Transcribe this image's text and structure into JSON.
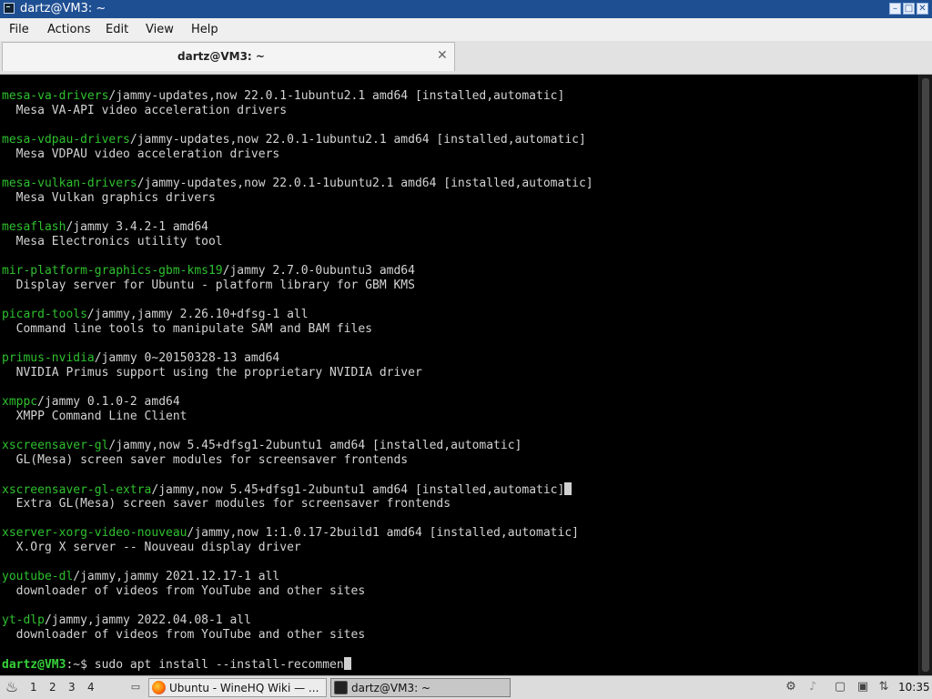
{
  "window": {
    "title": "dartz@VM3: ~",
    "buttons": {
      "minimize": "–",
      "maximize": "□",
      "close": "✕"
    }
  },
  "menu": {
    "items": [
      "File",
      "Actions",
      "Edit",
      "View",
      "Help"
    ]
  },
  "tab": {
    "label": "dartz@VM3: ~",
    "close": "✕"
  },
  "terminal": {
    "lines": [
      {
        "pkg": "mesa-va-drivers",
        "rest": "/jammy-updates,now 22.0.1-1ubuntu2.1 amd64 [installed,automatic]"
      },
      {
        "text": "  Mesa VA-API video acceleration drivers"
      },
      {
        "text": ""
      },
      {
        "pkg": "mesa-vdpau-drivers",
        "rest": "/jammy-updates,now 22.0.1-1ubuntu2.1 amd64 [installed,automatic]"
      },
      {
        "text": "  Mesa VDPAU video acceleration drivers"
      },
      {
        "text": ""
      },
      {
        "pkg": "mesa-vulkan-drivers",
        "rest": "/jammy-updates,now 22.0.1-1ubuntu2.1 amd64 [installed,automatic]"
      },
      {
        "text": "  Mesa Vulkan graphics drivers"
      },
      {
        "text": ""
      },
      {
        "pkg": "mesaflash",
        "rest": "/jammy 3.4.2-1 amd64"
      },
      {
        "text": "  Mesa Electronics utility tool"
      },
      {
        "text": ""
      },
      {
        "pkg": "mir-platform-graphics-gbm-kms19",
        "rest": "/jammy 2.7.0-0ubuntu3 amd64"
      },
      {
        "text": "  Display server for Ubuntu - platform library for GBM KMS"
      },
      {
        "text": ""
      },
      {
        "pkg": "picard-tools",
        "rest": "/jammy,jammy 2.26.10+dfsg-1 all"
      },
      {
        "text": "  Command line tools to manipulate SAM and BAM files"
      },
      {
        "text": ""
      },
      {
        "pkg": "primus-nvidia",
        "rest": "/jammy 0~20150328-13 amd64"
      },
      {
        "text": "  NVIDIA Primus support using the proprietary NVIDIA driver"
      },
      {
        "text": ""
      },
      {
        "pkg": "xmppc",
        "rest": "/jammy 0.1.0-2 amd64"
      },
      {
        "text": "  XMPP Command Line Client"
      },
      {
        "text": ""
      },
      {
        "pkg": "xscreensaver-gl",
        "rest": "/jammy,now 5.45+dfsg1-2ubuntu1 amd64 [installed,automatic]"
      },
      {
        "text": "  GL(Mesa) screen saver modules for screensaver frontends"
      },
      {
        "text": ""
      },
      {
        "pkg": "xscreensaver-gl-extra",
        "rest": "/jammy,now 5.45+dfsg1-2ubuntu1 amd64 [installed,automatic]",
        "cursor": true
      },
      {
        "text": "  Extra GL(Mesa) screen saver modules for screensaver frontends"
      },
      {
        "text": ""
      },
      {
        "pkg": "xserver-xorg-video-nouveau",
        "rest": "/jammy,now 1:1.0.17-2build1 amd64 [installed,automatic]"
      },
      {
        "text": "  X.Org X server -- Nouveau display driver"
      },
      {
        "text": ""
      },
      {
        "pkg": "youtube-dl",
        "rest": "/jammy,jammy 2021.12.17-1 all"
      },
      {
        "text": "  downloader of videos from YouTube and other sites"
      },
      {
        "text": ""
      },
      {
        "pkg": "yt-dlp",
        "rest": "/jammy,jammy 2022.04.08-1 all"
      },
      {
        "text": "  downloader of videos from YouTube and other sites"
      },
      {
        "text": ""
      },
      {
        "prompt": "dartz@VM3",
        "prompt_suffix": ":~$",
        "command": " sudo apt install --install-recommen",
        "cursor": true
      }
    ]
  },
  "taskbar": {
    "start_icon": "start-menu-icon",
    "workspaces": [
      "1",
      "2",
      "3",
      "4"
    ],
    "tasks": [
      {
        "label": "Ubuntu - WineHQ Wiki — ...",
        "icon": "firefox-icon",
        "active": false
      },
      {
        "label": "dartz@VM3: ~",
        "icon": "terminal-icon",
        "active": true
      }
    ],
    "clock": "10:35"
  },
  "colors": {
    "titlebar": "#1f4f93",
    "terminal_bg": "#000000",
    "terminal_fg": "#d3d3d3",
    "package_green": "#2ec02e",
    "prompt_green": "#36d13b"
  }
}
